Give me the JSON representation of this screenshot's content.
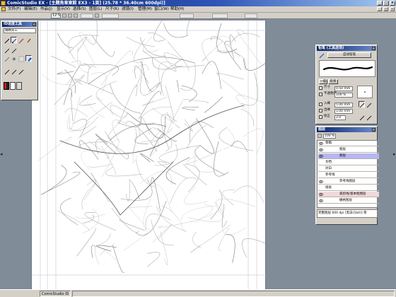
{
  "window": {
    "title": "ComicStudio EX - [主題角東東館 EX3 - 1頁] (25.78 * 36.40cm 600dpi)]",
    "controls": [
      "_",
      "□",
      "×"
    ]
  },
  "menubar": {
    "items": [
      "文件(F)",
      "编辑(E)",
      "作品(J)",
      "显示(V)",
      "选择(S)",
      "图层(L)",
      "尺子(R)",
      "滤镜(I)",
      "管理(M)",
      "窗口(W)",
      "帮助(H)"
    ],
    "doc_controls": [
      "_",
      "□",
      "×"
    ]
  },
  "toolbar": {
    "zoom": "12.5"
  },
  "tool_panel": {
    "title": "ID进度工具",
    "subtool_field": "眼睛光工"
  },
  "brush_panel": {
    "title": "铅笔 (工具选项)",
    "tool_name": "自动铅笔",
    "tab_labels": [
      "一般",
      "形状"
    ],
    "size_label": "尺寸",
    "size_value": "0.50 mm",
    "opacity_label": "不透明度",
    "opacity_value": "100 %",
    "in_label": "入峰",
    "in_value": "5.00 mm",
    "out_label": "出峰",
    "out_value": "5.00 mm",
    "correction_label": "修正",
    "correction_value": "2.0"
  },
  "layers_panel": {
    "title": "图层",
    "opacity": "100 %",
    "rows": [
      {
        "name": "草稿",
        "type": "group"
      },
      {
        "name": "图层",
        "type": "layer"
      },
      {
        "name": "图层",
        "type": "layer",
        "selected": true
      },
      {
        "name": "文档",
        "type": "group"
      },
      {
        "name": "对白",
        "type": "group"
      },
      {
        "name": "参考线",
        "type": "group"
      },
      {
        "name": "参考线图层",
        "type": "layer"
      },
      {
        "name": "纸张",
        "type": "group"
      },
      {
        "name": "裁剪线/基本框图层",
        "type": "layer"
      },
      {
        "name": "栅格图层",
        "type": "layer"
      }
    ],
    "footer": "完整图层 600 dpi [黑白(1bit)] 草"
  },
  "status_bar": {
    "app_label": "ComicStudio ID"
  }
}
